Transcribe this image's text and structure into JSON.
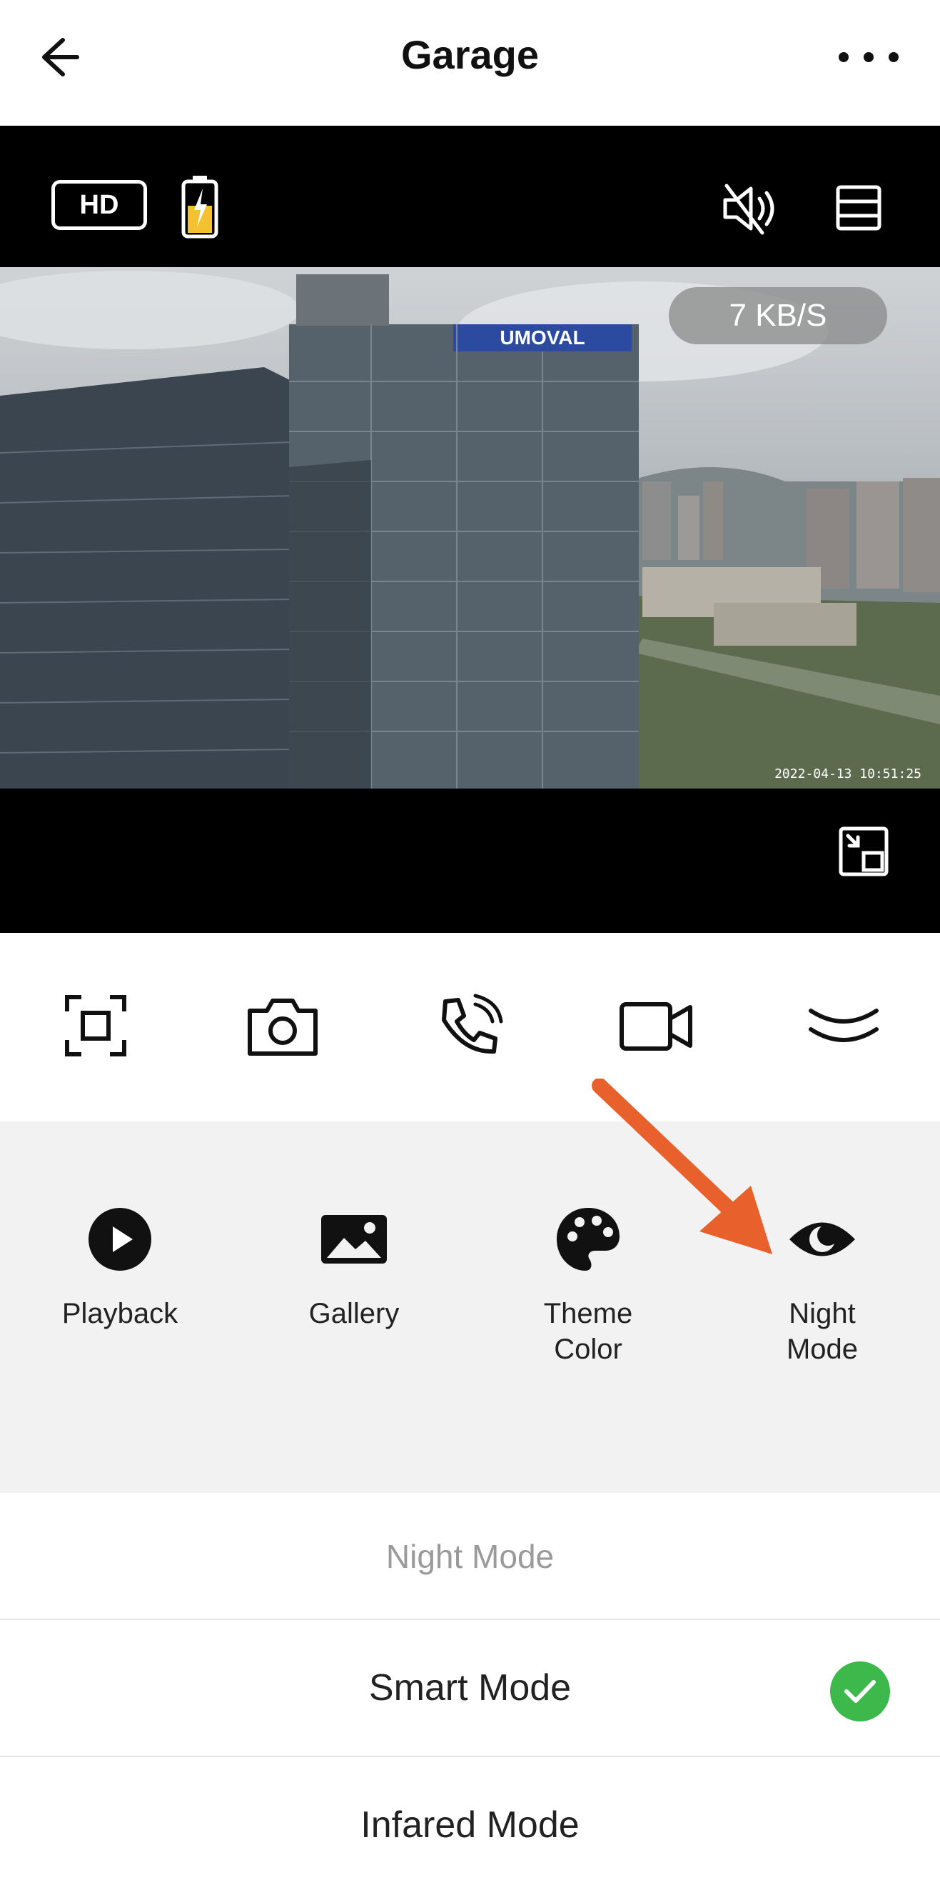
{
  "header": {
    "title": "Garage",
    "back_icon": "arrow-left-icon",
    "more_icon": "more-horizontal-icon"
  },
  "video": {
    "hd_label": "HD",
    "battery_icon": "battery-charging-icon",
    "mute_icon": "speaker-muted-icon",
    "layout_icon": "layout-split-icon",
    "speed": "7 KB/S",
    "timestamp": "2022-04-13 10:51:25",
    "overlay_sign": "UMOVAL",
    "pip_icon": "picture-in-picture-icon"
  },
  "controls": [
    {
      "icon": "screenshot-icon"
    },
    {
      "icon": "camera-icon"
    },
    {
      "icon": "phone-call-icon"
    },
    {
      "icon": "video-record-icon"
    },
    {
      "icon": "chevron-double-down-icon"
    }
  ],
  "features": [
    {
      "label": "Playback",
      "icon": "play-circle-icon"
    },
    {
      "label": "Gallery",
      "icon": "image-icon"
    },
    {
      "label": "Theme\nColor",
      "icon": "palette-icon"
    },
    {
      "label": "Night\nMode",
      "icon": "eye-moon-icon"
    }
  ],
  "sheet": {
    "title": "Night Mode",
    "options": [
      {
        "label": "Smart Mode",
        "selected": true
      },
      {
        "label": "Infared Mode",
        "selected": false
      }
    ]
  },
  "colors": {
    "accent_green": "#3db84a",
    "annotation_arrow": "#e8612c",
    "battery_fill": "#f2c230"
  }
}
